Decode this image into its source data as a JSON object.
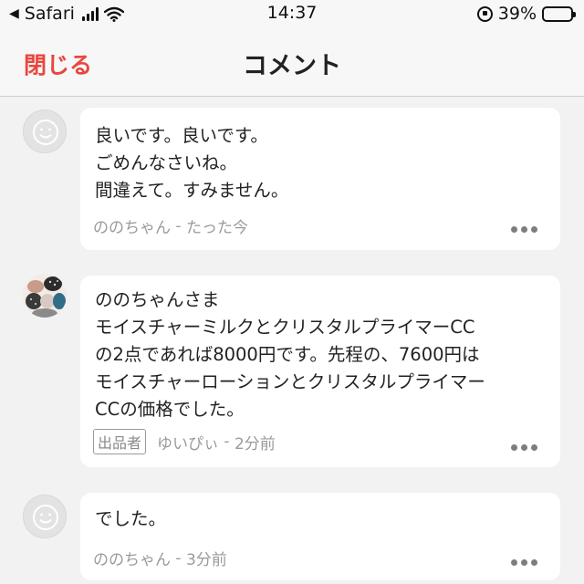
{
  "status_bar": {
    "back_app": "Safari",
    "time": "14:37",
    "battery": "39%",
    "battery_level": 0.39
  },
  "nav": {
    "close_label": "閉じる",
    "title": "コメント"
  },
  "comments": [
    {
      "lines": [
        "良いです。良いです。",
        "ごめんなさいね。",
        "間違えて。すみません。"
      ],
      "author": "ののちゃん",
      "time": "たった今",
      "avatar": "default-face-icon"
    },
    {
      "lines": [
        "ののちゃんさま",
        "モイスチャーミルクとクリスタルプライマーCC",
        "の2点であれば8000円です。先程の、7600円は",
        "モイスチャーローションとクリスタルプライマー",
        "CCの価格でした。"
      ],
      "badge": "出品者",
      "author": "ゆいぴぃ",
      "time": "2分前",
      "avatar": "user-photo"
    },
    {
      "lines": [
        "でした。"
      ],
      "author": "ののちゃん",
      "time": "3分前",
      "avatar": "default-face-icon"
    }
  ],
  "meta_separator": " - "
}
